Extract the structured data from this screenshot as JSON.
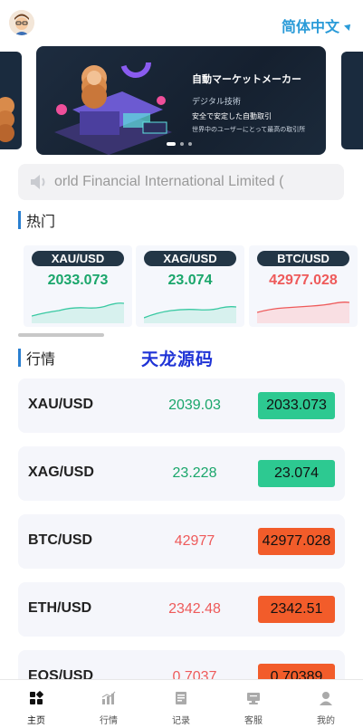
{
  "header": {
    "language": "简体中文"
  },
  "banner": {
    "title": "自動マーケットメーカー",
    "subtitle": "デジタル技術",
    "line1": "安全で安定した自動取引",
    "line2": "世界中のユーザーにとって最高の取引所"
  },
  "notice": {
    "text": "orld Financial International Limited ("
  },
  "hot": {
    "title": "热门",
    "cards": [
      {
        "symbol": "XAU/USD",
        "price": "2033.073",
        "trend": "up",
        "color": "#1aa66b"
      },
      {
        "symbol": "XAG/USD",
        "price": "23.074",
        "trend": "up",
        "color": "#1aa66b"
      },
      {
        "symbol": "BTC/USD",
        "price": "42977.028",
        "trend": "down",
        "color": "#ee5a5a"
      }
    ]
  },
  "market": {
    "title": "行情",
    "watermark": "天龙源码",
    "rows": [
      {
        "symbol": "XAU/USD",
        "prev": "2039.03",
        "price": "2033.073",
        "dir": "up"
      },
      {
        "symbol": "XAG/USD",
        "prev": "23.228",
        "price": "23.074",
        "dir": "up"
      },
      {
        "symbol": "BTC/USD",
        "prev": "42977",
        "price": "42977.028",
        "dir": "down"
      },
      {
        "symbol": "ETH/USD",
        "prev": "2342.48",
        "price": "2342.51",
        "dir": "down"
      },
      {
        "symbol": "EOS/USD",
        "prev": "0.7037",
        "price": "0.70389",
        "dir": "down"
      }
    ]
  },
  "colors": {
    "up": "#2dc991",
    "down": "#f25c2a",
    "upText": "#1aa66b",
    "downText": "#ee5a5a",
    "accent": "#2a9bd8"
  },
  "tabs": [
    {
      "label": "主页",
      "icon": "home-grid-icon",
      "active": true
    },
    {
      "label": "行情",
      "icon": "market-chart-icon",
      "active": false
    },
    {
      "label": "记录",
      "icon": "records-icon",
      "active": false
    },
    {
      "label": "客服",
      "icon": "customer-service-icon",
      "active": false
    },
    {
      "label": "我的",
      "icon": "profile-icon",
      "active": false
    }
  ]
}
